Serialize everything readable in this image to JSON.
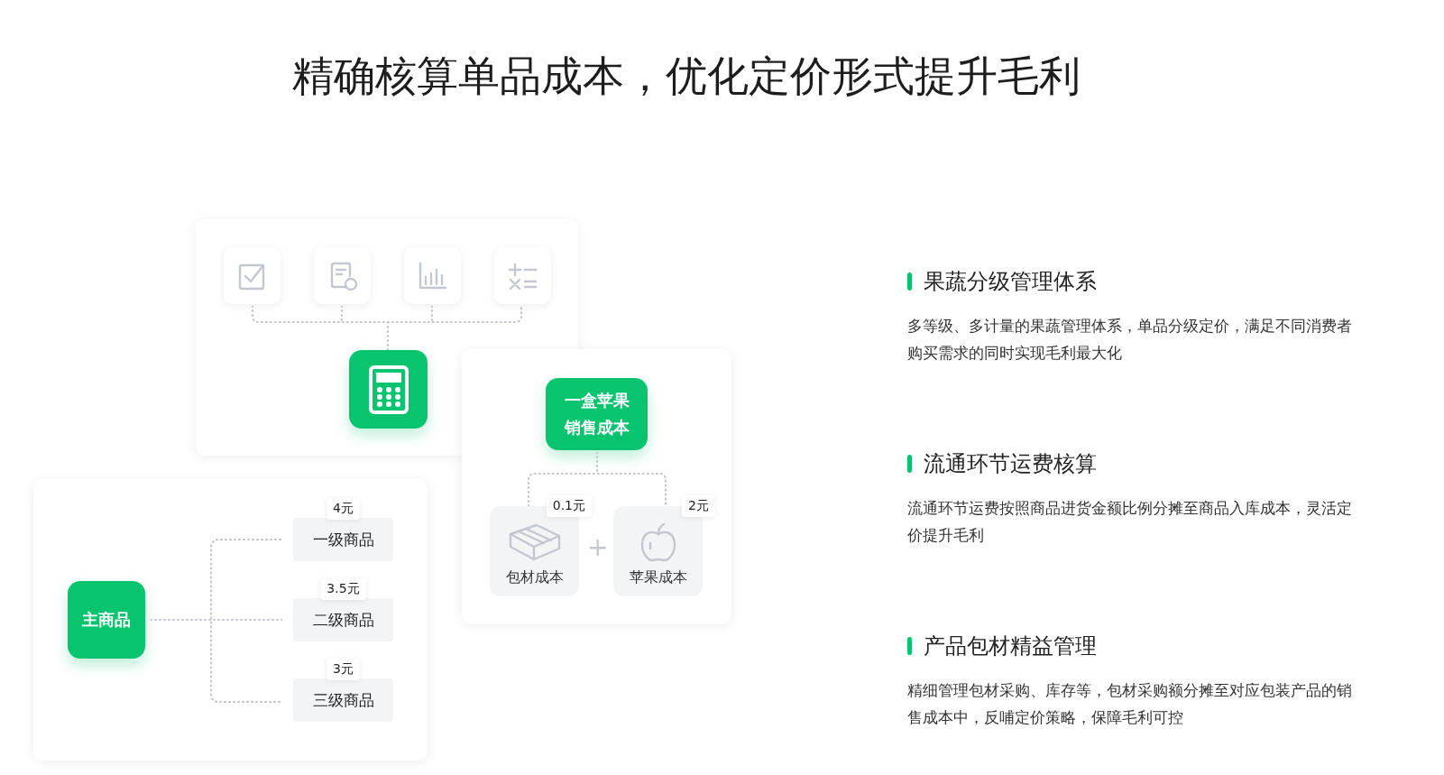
{
  "title": "精确核算单品成本，优化定价形式提升毛利",
  "cost_card": {
    "total": "一盒苹果销售成本",
    "operator": "+",
    "parts": [
      {
        "kind": "box",
        "label": "包材成本",
        "price": "0.1元"
      },
      {
        "kind": "apple",
        "label": "苹果成本",
        "price": "2元"
      }
    ]
  },
  "grade_card": {
    "main": "主商品",
    "grades": [
      {
        "label": "一级商品",
        "price": "4元"
      },
      {
        "label": "二级商品",
        "price": "3.5元"
      },
      {
        "label": "三级商品",
        "price": "3元"
      }
    ]
  },
  "features": [
    {
      "heading": "果蔬分级管理体系",
      "text": "多等级、多计量的果蔬管理体系，单品分级定价，满足不同消费者购买需求的同时实现毛利最大化"
    },
    {
      "heading": "流通环节运费核算",
      "text": "流通环节运费按照商品进货金额比例分摊至商品入库成本，灵活定价提升毛利"
    },
    {
      "heading": "产品包材精益管理",
      "text": "精细管理包材采购、库存等，包材采购额分摊至对应包装产品的销售成本中，反哺定价策略，保障毛利可控"
    }
  ]
}
